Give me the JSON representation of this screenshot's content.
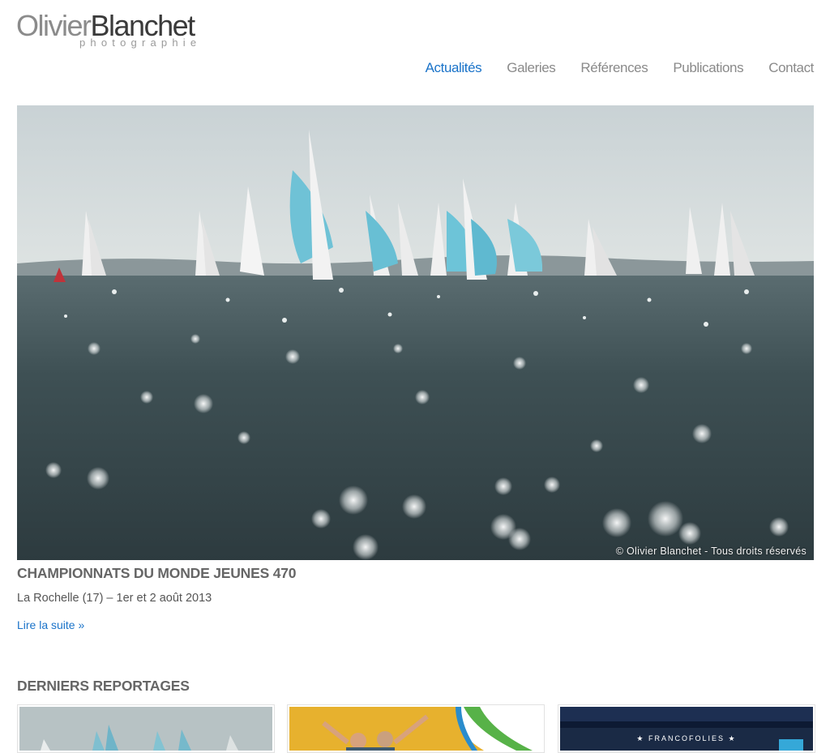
{
  "logo": {
    "first": "Olivier",
    "last": "Blanchet",
    "sub": "photographie"
  },
  "nav": [
    {
      "label": "Actualités",
      "active": true
    },
    {
      "label": "Galeries",
      "active": false
    },
    {
      "label": "Références",
      "active": false
    },
    {
      "label": "Publications",
      "active": false
    },
    {
      "label": "Contact",
      "active": false
    }
  ],
  "hero": {
    "copyright": "© Olivier Blanchet - Tous droits réservés",
    "title": "CHAMPIONNATS DU MONDE JEUNES 470",
    "subtitle": "La Rochelle (17) – 1er et 2 août 2013",
    "read_more": "Lire la suite »"
  },
  "reportages": {
    "title": "DERNIERS REPORTAGES",
    "thumbs": [
      {
        "name": "sailing-regatta"
      },
      {
        "name": "sailors-celebrating"
      },
      {
        "name": "francofolies-stage",
        "caption": "★ FRANCOFOLIES ★"
      }
    ]
  },
  "colors": {
    "accent": "#1a73c9",
    "heading": "#666666",
    "nav": "#8a8a8a"
  }
}
